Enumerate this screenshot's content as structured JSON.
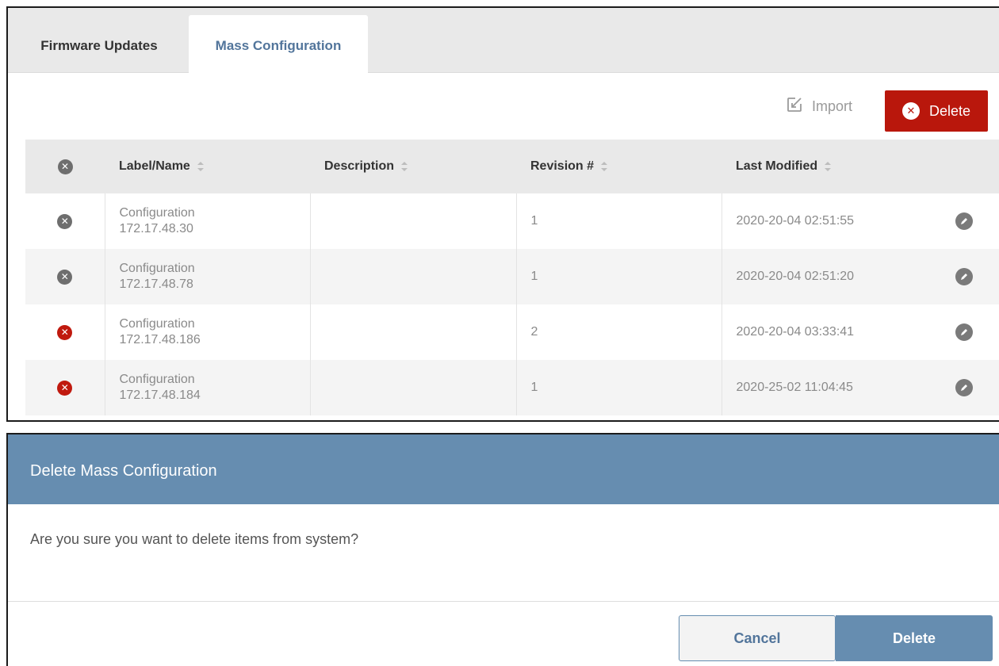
{
  "tabs": [
    {
      "label": "Firmware Updates",
      "active": false
    },
    {
      "label": "Mass Configuration",
      "active": true
    }
  ],
  "toolbar": {
    "import_label": "Import",
    "delete_label": "Delete",
    "import_icon": "import-icon",
    "delete_icon": "close-circle-icon"
  },
  "table": {
    "columns": [
      "Label/Name",
      "Description",
      "Revision #",
      "Last Modified"
    ],
    "rows": [
      {
        "selected": false,
        "name": "Configuration",
        "ip": "172.17.48.30",
        "description": "",
        "revision": "1",
        "modified": "2020-20-04 02:51:55"
      },
      {
        "selected": false,
        "name": "Configuration",
        "ip": "172.17.48.78",
        "description": "",
        "revision": "1",
        "modified": "2020-20-04 02:51:20"
      },
      {
        "selected": true,
        "name": "Configuration",
        "ip": "172.17.48.186",
        "description": "",
        "revision": "2",
        "modified": "2020-20-04 03:33:41"
      },
      {
        "selected": true,
        "name": "Configuration",
        "ip": "172.17.48.184",
        "description": "",
        "revision": "1",
        "modified": "2020-25-02 11:04:45"
      }
    ]
  },
  "dialog": {
    "title": "Delete Mass Configuration",
    "message": "Are you sure you want to delete items from system?",
    "cancel_label": "Cancel",
    "delete_label": "Delete"
  },
  "colors": {
    "accent": "#668db0",
    "accent_text": "#52759b",
    "danger": "#b9170c",
    "tab_bar": "#e9e9e9"
  }
}
